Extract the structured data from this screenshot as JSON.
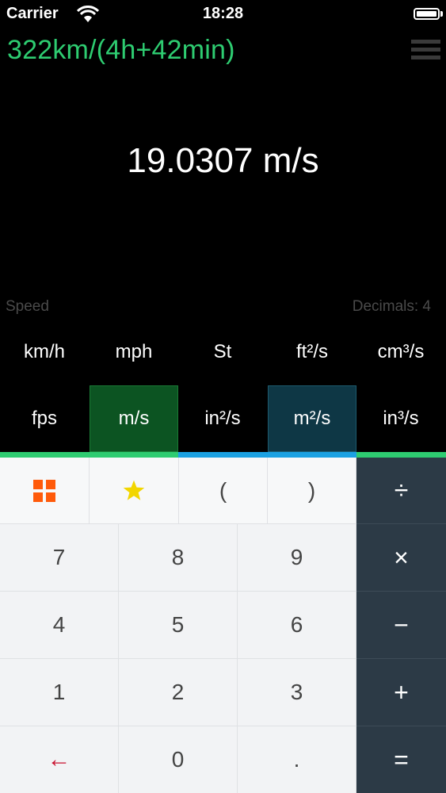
{
  "status_bar": {
    "carrier": "Carrier",
    "time": "18:28"
  },
  "expression": "322km/(4h+42min)",
  "result": "19.0307 m/s",
  "category": "Speed",
  "decimals_label": "Decimals: 4",
  "units": {
    "row1": [
      "km/h",
      "mph",
      "St",
      "ft²/s",
      "cm³/s"
    ],
    "row2": [
      "fps",
      "m/s",
      "in²/s",
      "m²/s",
      "in³/s"
    ],
    "selected_primary": "m/s",
    "selected_secondary": "m²/s"
  },
  "keypad": {
    "top_row": {
      "grid": "grid-icon",
      "favorite": "star-icon",
      "open_paren": "(",
      "close_paren": ")",
      "divide": "÷"
    },
    "rows": [
      [
        "7",
        "8",
        "9",
        "×"
      ],
      [
        "4",
        "5",
        "6",
        "−"
      ],
      [
        "1",
        "2",
        "3",
        "+"
      ],
      [
        "←",
        "0",
        ".",
        "="
      ]
    ]
  },
  "colors": {
    "accent_green": "#2ecc71",
    "accent_blue": "#1ba1e2",
    "operator_bg": "#2c3a46",
    "grid_orange": "#ff5a0a",
    "star_yellow": "#f2d600",
    "backspace_red": "#c8102e"
  }
}
